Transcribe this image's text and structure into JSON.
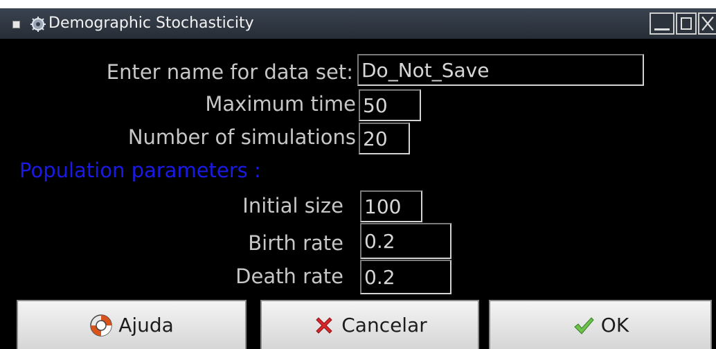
{
  "window": {
    "title": "Demographic Stochasticity"
  },
  "form": {
    "dataset_label": "Enter name for data set:",
    "dataset_value": "Do_Not_Save",
    "max_time_label": "Maximum time",
    "max_time_value": "50",
    "num_sims_label": "Number of simulations",
    "num_sims_value": "20",
    "section_heading": "Population parameters :",
    "initial_size_label": "Initial size",
    "initial_size_value": "100",
    "birth_rate_label": "Birth rate",
    "birth_rate_value": "0.2",
    "death_rate_label": "Death rate",
    "death_rate_value": "0.2"
  },
  "buttons": {
    "help_label": "Ajuda",
    "help_icon": "lifebuoy-icon",
    "cancel_label": "Cancelar",
    "cancel_icon": "red-x-icon",
    "ok_label": "OK",
    "ok_icon": "green-check-icon"
  },
  "colors": {
    "background": "#000000",
    "label_text": "#c7c7c7",
    "section_heading": "#1a1ae6",
    "button_face": "#e6e6e6"
  }
}
